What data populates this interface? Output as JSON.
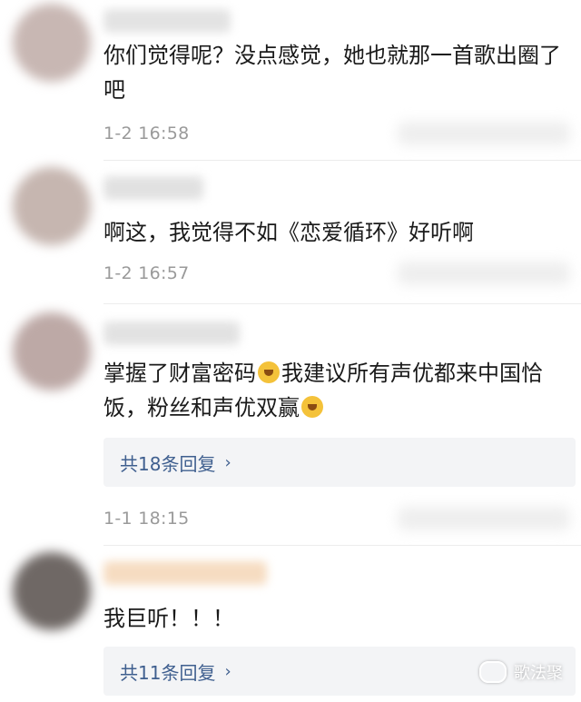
{
  "comments": [
    {
      "text": "你们觉得呢？没点感觉，她也就那一首歌出圈了吧",
      "time": "1-2 16:58",
      "avatar_color": "#c8b7b3"
    },
    {
      "text": "啊这，我觉得不如《恋爱循环》好听啊",
      "time": "1-2 16:57",
      "avatar_color": "#c6b6b0"
    },
    {
      "text_part1": "掌握了财富密码",
      "text_part2": "我建议所有声优都来中国恰饭，粉丝和声优双赢",
      "emoji1": "smirk-face-emoji",
      "emoji2": "shocked-face-emoji",
      "replies": "共18条回复",
      "time": "1-1 18:15",
      "avatar_color": "#bda9a6"
    },
    {
      "text": "我巨听！！！",
      "replies": "共11条回复",
      "avatar_color": "#6f6865",
      "name_color": "#f6dcc1"
    }
  ],
  "watermark": {
    "text": "歌法聚",
    "icon": "wechat-icon"
  },
  "chevron_icon": "chevron-right-icon"
}
